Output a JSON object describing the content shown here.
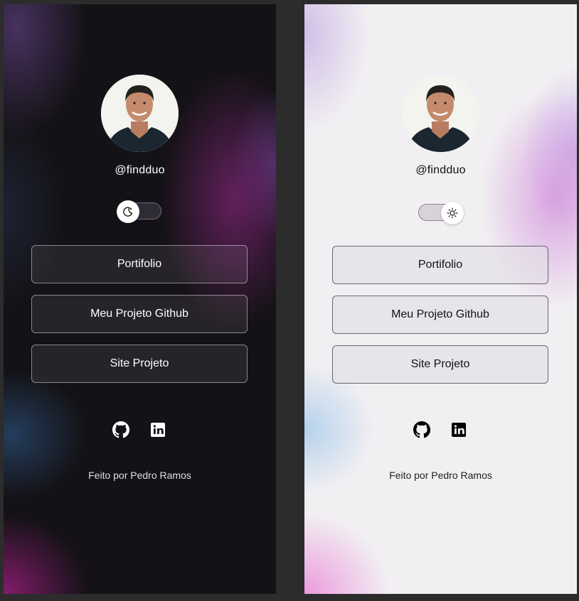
{
  "profile": {
    "username": "@findduo"
  },
  "theme_toggle": {
    "dark_icon": "moon-icon",
    "light_icon": "sun-icon"
  },
  "links": [
    {
      "label": "Portifolio"
    },
    {
      "label": "Meu Projeto Github"
    },
    {
      "label": "Site Projeto"
    }
  ],
  "social": {
    "github_icon": "github-icon",
    "linkedin_icon": "linkedin-icon"
  },
  "footer": {
    "credit": "Feito por Pedro Ramos"
  },
  "colors": {
    "dark_background": "#141216",
    "light_background": "#f1eff2",
    "canvas": "#2c2c2c"
  }
}
